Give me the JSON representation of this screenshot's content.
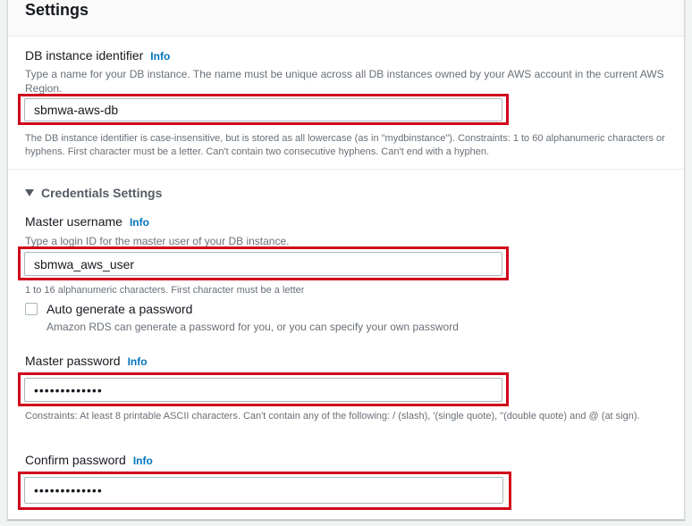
{
  "settings": {
    "title": "Settings"
  },
  "db_identifier": {
    "label": "DB instance identifier",
    "info": "Info",
    "description": "Type a name for your DB instance. The name must be unique across all DB instances owned by your AWS account in the current AWS Region.",
    "value": "sbmwa-aws-db",
    "constraint": "The DB instance identifier is case-insensitive, but is stored as all lowercase (as in \"mydbinstance\"). Constraints: 1 to 60 alphanumeric characters or hyphens. First character must be a letter. Can't contain two consecutive hyphens. Can't end with a hyphen."
  },
  "credentials": {
    "section_title": "Credentials Settings",
    "master_username": {
      "label": "Master username",
      "info": "Info",
      "description": "Type a login ID for the master user of your DB instance.",
      "value": "sbmwa_aws_user",
      "constraint": "1 to 16 alphanumeric characters. First character must be a letter"
    },
    "auto_generate": {
      "label": "Auto generate a password",
      "description": "Amazon RDS can generate a password for you, or you can specify your own password"
    },
    "master_password": {
      "label": "Master password",
      "info": "Info",
      "value": "•••••••••••••",
      "constraint": "Constraints: At least 8 printable ASCII characters. Can't contain any of the following: / (slash), '(single quote), \"(double quote) and @ (at sign)."
    },
    "confirm_password": {
      "label": "Confirm password",
      "info": "Info",
      "value": "•••••••••••••"
    }
  },
  "colors": {
    "highlight": "#d0021b",
    "link": "#0073bb"
  }
}
